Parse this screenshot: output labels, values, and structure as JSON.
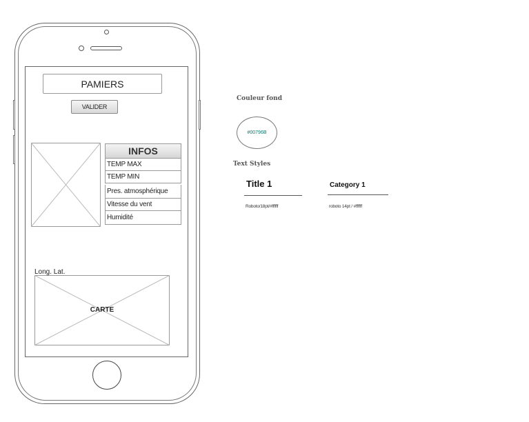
{
  "screen": {
    "city_value": "PAMIERS",
    "validate_label": "VALIDER",
    "infos": {
      "header": "INFOS",
      "rows": [
        "TEMP MAX",
        "TEMP MIN",
        "Pres. atmosphérique",
        "Vitesse du vent",
        "Humidité"
      ]
    },
    "coords_label": "Long. Lat.",
    "map_label": "CARTE"
  },
  "style_guide": {
    "background_title": "Couleur fond",
    "background_color": "#00796B",
    "text_styles_title": "Text Styles",
    "title_sample": "Title 1",
    "title_meta": "Roboto/18pt/#ffffff",
    "category_sample": "Category 1",
    "category_meta": "roboto 14pt / #ffffff"
  }
}
